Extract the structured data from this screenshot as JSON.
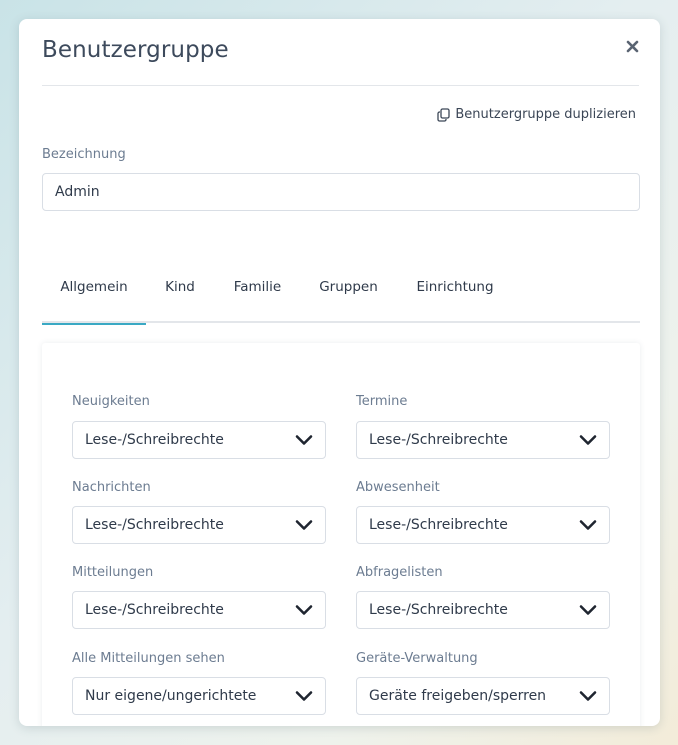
{
  "dialog": {
    "title": "Benutzergruppe",
    "duplicate_label": "Benutzergruppe duplizieren"
  },
  "name_field": {
    "label": "Bezeichnung",
    "value": "Admin"
  },
  "tabs": [
    {
      "label": "Allgemein",
      "active": true
    },
    {
      "label": "Kind",
      "active": false
    },
    {
      "label": "Familie",
      "active": false
    },
    {
      "label": "Gruppen",
      "active": false
    },
    {
      "label": "Einrichtung",
      "active": false
    }
  ],
  "permissions": [
    {
      "label": "Neuigkeiten",
      "value": "Lese-/Schreibrechte"
    },
    {
      "label": "Termine",
      "value": "Lese-/Schreibrechte"
    },
    {
      "label": "Nachrichten",
      "value": "Lese-/Schreibrechte"
    },
    {
      "label": "Abwesenheit",
      "value": "Lese-/Schreibrechte"
    },
    {
      "label": "Mitteilungen",
      "value": "Lese-/Schreibrechte"
    },
    {
      "label": "Abfragelisten",
      "value": "Lese-/Schreibrechte"
    },
    {
      "label": "Alle Mitteilungen sehen",
      "value": "Nur eigene/ungerichtete"
    },
    {
      "label": "Geräte-Verwaltung",
      "value": "Geräte freigeben/sperren"
    }
  ],
  "colors": {
    "accent": "#3aa9c4",
    "title_text": "#3d4a5c",
    "label_text": "#6c7c91"
  }
}
